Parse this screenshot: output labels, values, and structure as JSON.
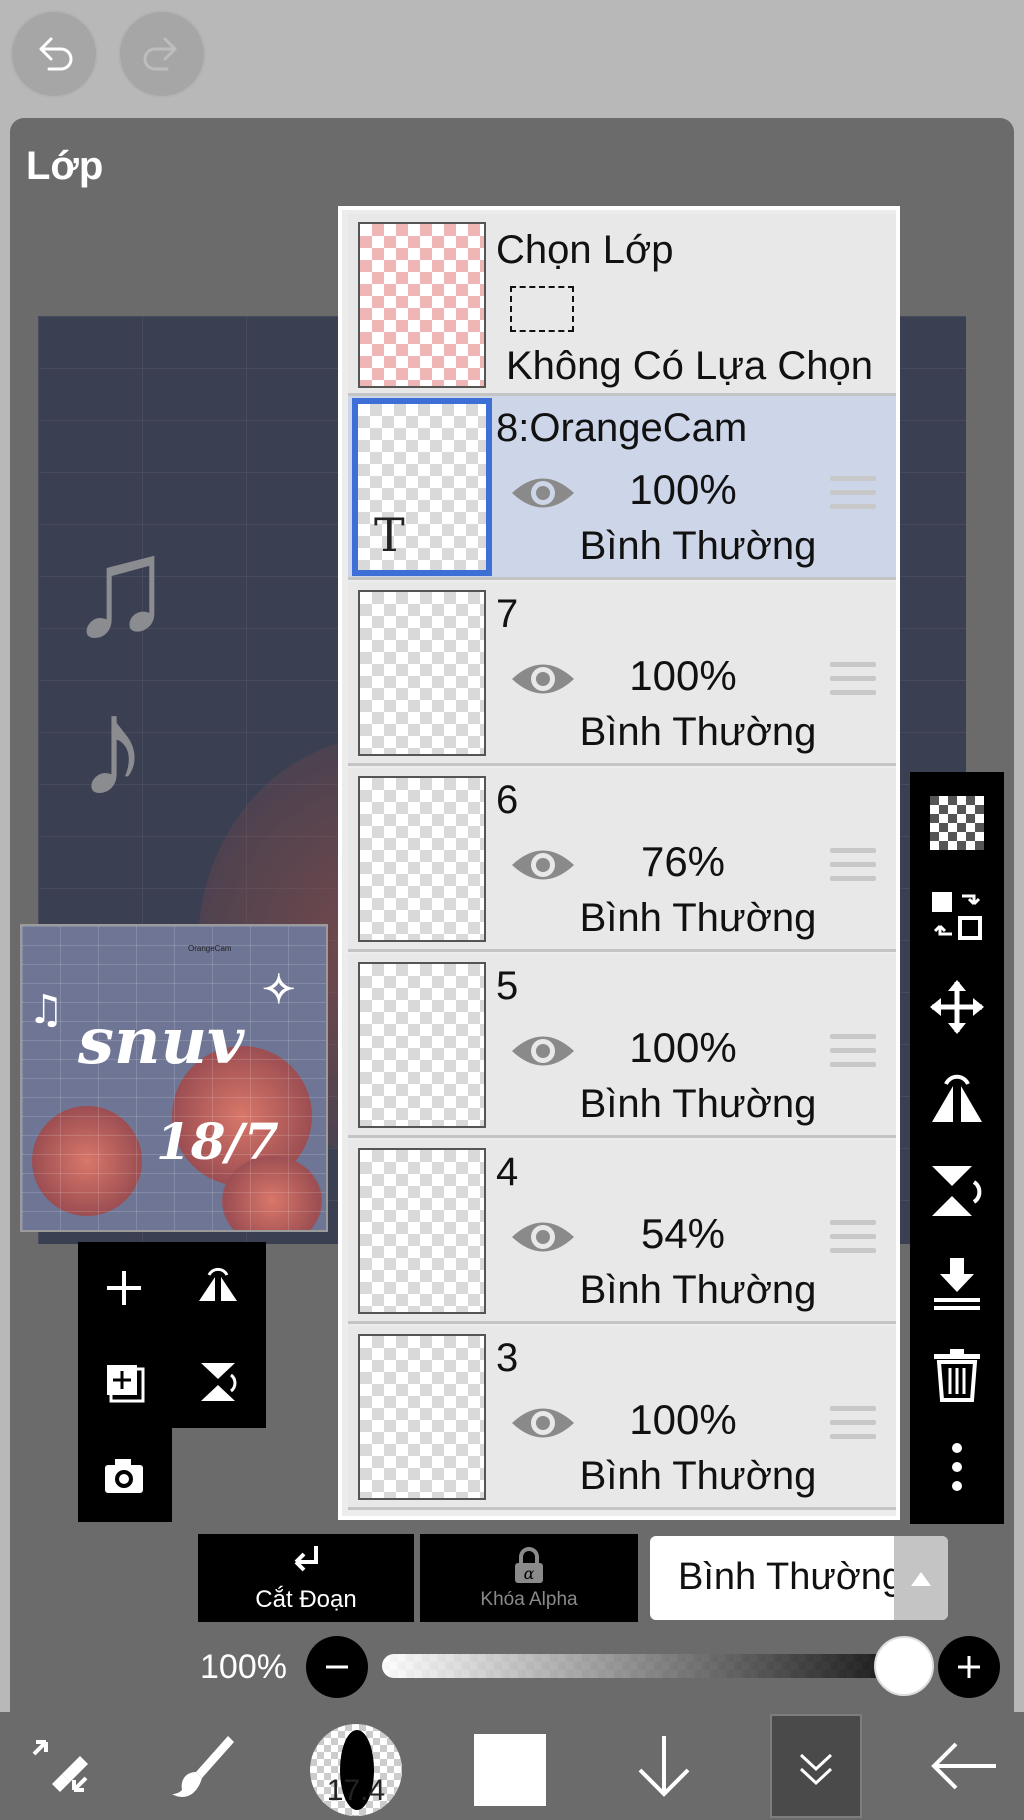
{
  "panel": {
    "title": "Lớp"
  },
  "selection": {
    "title": "Chọn Lớp",
    "status": "Không Có Lựa Chọn"
  },
  "layers": [
    {
      "name": "8:OrangeCam",
      "opacity": "100%",
      "blend": "Bình Thường",
      "selected": true,
      "type": "text"
    },
    {
      "name": "7",
      "opacity": "100%",
      "blend": "Bình Thường",
      "selected": false
    },
    {
      "name": "6",
      "opacity": "76%",
      "blend": "Bình Thường",
      "selected": false
    },
    {
      "name": "5",
      "opacity": "100%",
      "blend": "Bình Thường",
      "selected": false
    },
    {
      "name": "4",
      "opacity": "54%",
      "blend": "Bình Thường",
      "selected": false
    },
    {
      "name": "3",
      "opacity": "100%",
      "blend": "Bình Thường",
      "selected": false
    }
  ],
  "actions": {
    "clip_label": "Cắt Đoạn",
    "alpha_lock_label": "Khóa Alpha",
    "blend_mode": "Bình Thường"
  },
  "opacity": {
    "label": "100%",
    "value": 1.0
  },
  "brush": {
    "size": "17.4"
  },
  "preview": {
    "main_text": "snuv",
    "date_text": "18/7",
    "small_text": "OrangeCam"
  },
  "colors": {
    "panel": "#6b6b6b",
    "selected_row": "#cdd5e8",
    "selected_border": "#3d6fd6",
    "toolbar": "#000000"
  },
  "icons": [
    "undo-icon",
    "redo-icon",
    "add-layer-icon",
    "flip-horizontal-icon",
    "duplicate-layer-icon",
    "flip-vertical-icon",
    "camera-icon",
    "transparency-icon",
    "swap-icon",
    "move-icon",
    "merge-down-icon",
    "delete-icon",
    "more-icon",
    "eye-icon",
    "drag-handle-icon",
    "clip-icon",
    "lock-icon",
    "transform-tool-icon",
    "brush-icon",
    "arrow-down-icon",
    "chevrons-down-icon",
    "back-arrow-icon"
  ]
}
